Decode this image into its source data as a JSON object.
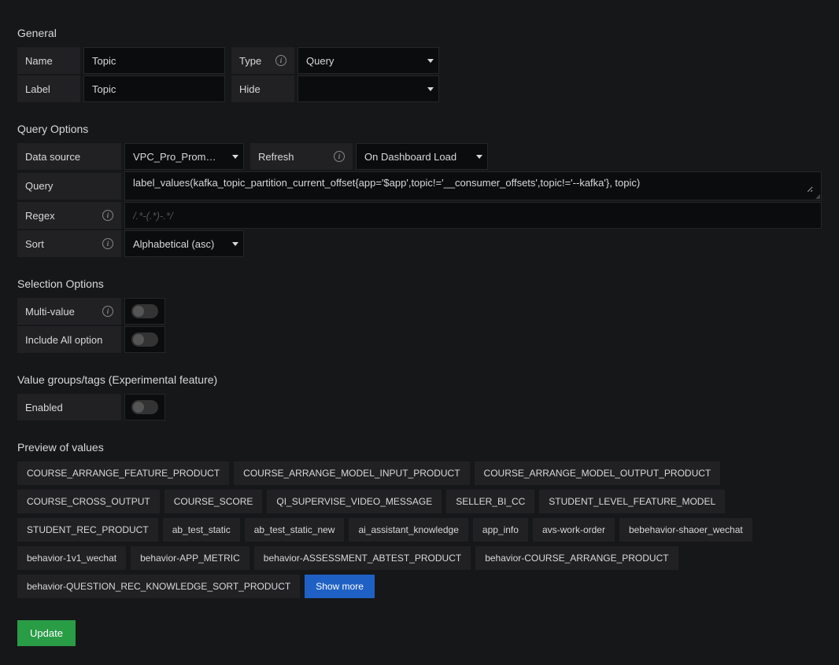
{
  "sections": {
    "general": "General",
    "queryOptions": "Query Options",
    "selectionOptions": "Selection Options",
    "valueGroups": "Value groups/tags (Experimental feature)",
    "preview": "Preview of values"
  },
  "general": {
    "nameLabel": "Name",
    "nameValue": "Topic",
    "typeLabel": "Type",
    "typeValue": "Query",
    "labelLabel": "Label",
    "labelValue": "Topic",
    "hideLabel": "Hide",
    "hideValue": ""
  },
  "queryOptions": {
    "dataSourceLabel": "Data source",
    "dataSourceValue": "VPC_Pro_Prometh",
    "refreshLabel": "Refresh",
    "refreshValue": "On Dashboard Load",
    "queryLabel": "Query",
    "queryValue": "label_values(kafka_topic_partition_current_offset{app='$app',topic!='__consumer_offsets',topic!='--kafka'}, topic)",
    "regexLabel": "Regex",
    "regexPlaceholder": "/.*-(.*)-.*/",
    "regexValue": "",
    "sortLabel": "Sort",
    "sortValue": "Alphabetical (asc)"
  },
  "selectionOptions": {
    "multiValueLabel": "Multi-value",
    "includeAllLabel": "Include All option"
  },
  "valueGroups": {
    "enabledLabel": "Enabled"
  },
  "preview": {
    "values": [
      "COURSE_ARRANGE_FEATURE_PRODUCT",
      "COURSE_ARRANGE_MODEL_INPUT_PRODUCT",
      "COURSE_ARRANGE_MODEL_OUTPUT_PRODUCT",
      "COURSE_CROSS_OUTPUT",
      "COURSE_SCORE",
      "QI_SUPERVISE_VIDEO_MESSAGE",
      "SELLER_BI_CC",
      "STUDENT_LEVEL_FEATURE_MODEL",
      "STUDENT_REC_PRODUCT",
      "ab_test_static",
      "ab_test_static_new",
      "ai_assistant_knowledge",
      "app_info",
      "avs-work-order",
      "bebehavior-shaoer_wechat",
      "behavior-1v1_wechat",
      "behavior-APP_METRIC",
      "behavior-ASSESSMENT_ABTEST_PRODUCT",
      "behavior-COURSE_ARRANGE_PRODUCT",
      "behavior-QUESTION_REC_KNOWLEDGE_SORT_PRODUCT"
    ],
    "showMoreLabel": "Show more"
  },
  "buttons": {
    "update": "Update"
  }
}
